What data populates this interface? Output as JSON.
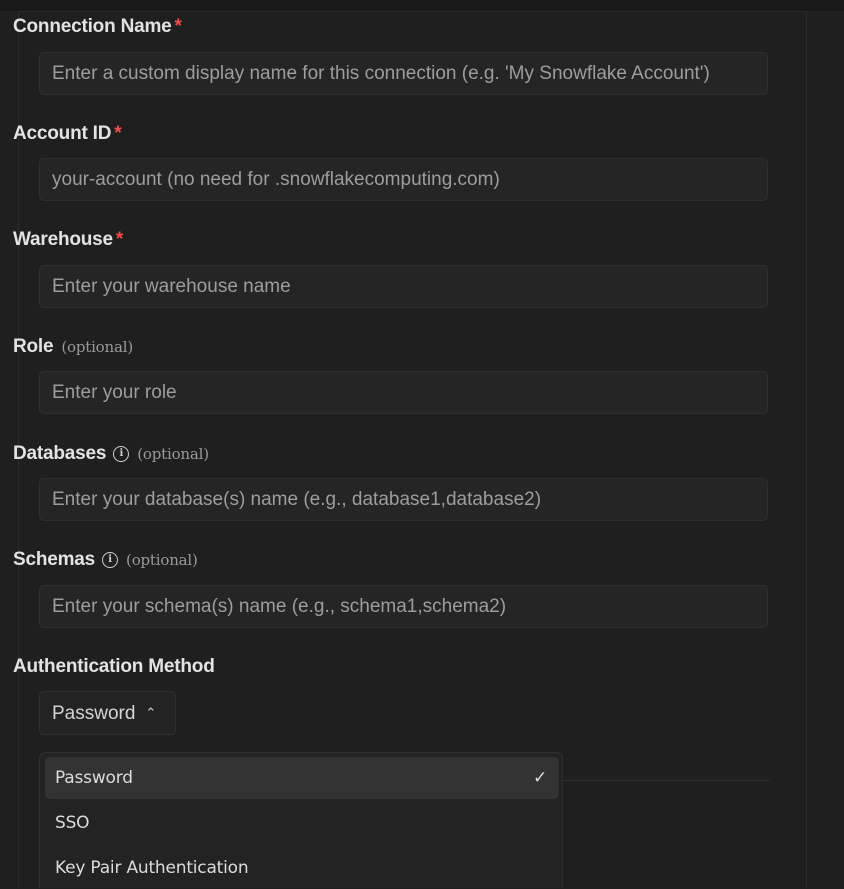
{
  "form": {
    "connection_name": {
      "label": "Connection Name",
      "required_mark": "*",
      "placeholder": "Enter a custom display name for this connection (e.g. 'My Snowflake Account')"
    },
    "account_id": {
      "label": "Account ID",
      "required_mark": "*",
      "placeholder": "your-account (no need for .snowflakecomputing.com)"
    },
    "warehouse": {
      "label": "Warehouse",
      "required_mark": "*",
      "placeholder": "Enter your warehouse name"
    },
    "role": {
      "label": "Role",
      "optional_text": "(optional)",
      "placeholder": "Enter your role"
    },
    "databases": {
      "label": "Databases",
      "optional_text": "(optional)",
      "info_icon": "info-icon",
      "placeholder": "Enter your database(s) name (e.g., database1,database2)"
    },
    "schemas": {
      "label": "Schemas",
      "optional_text": "(optional)",
      "info_icon": "info-icon",
      "placeholder": "Enter your schema(s) name (e.g., schema1,schema2)"
    },
    "auth": {
      "label": "Authentication Method",
      "selected": "Password",
      "chevron_icon": "chevron-up-icon",
      "options": [
        "Password",
        "SSO",
        "Key Pair Authentication"
      ],
      "check_icon": "check-icon"
    }
  },
  "colors": {
    "background": "#1f1f1f",
    "input_bg": "#252525",
    "required": "#f14c4c",
    "muted": "#9a9a9a"
  }
}
